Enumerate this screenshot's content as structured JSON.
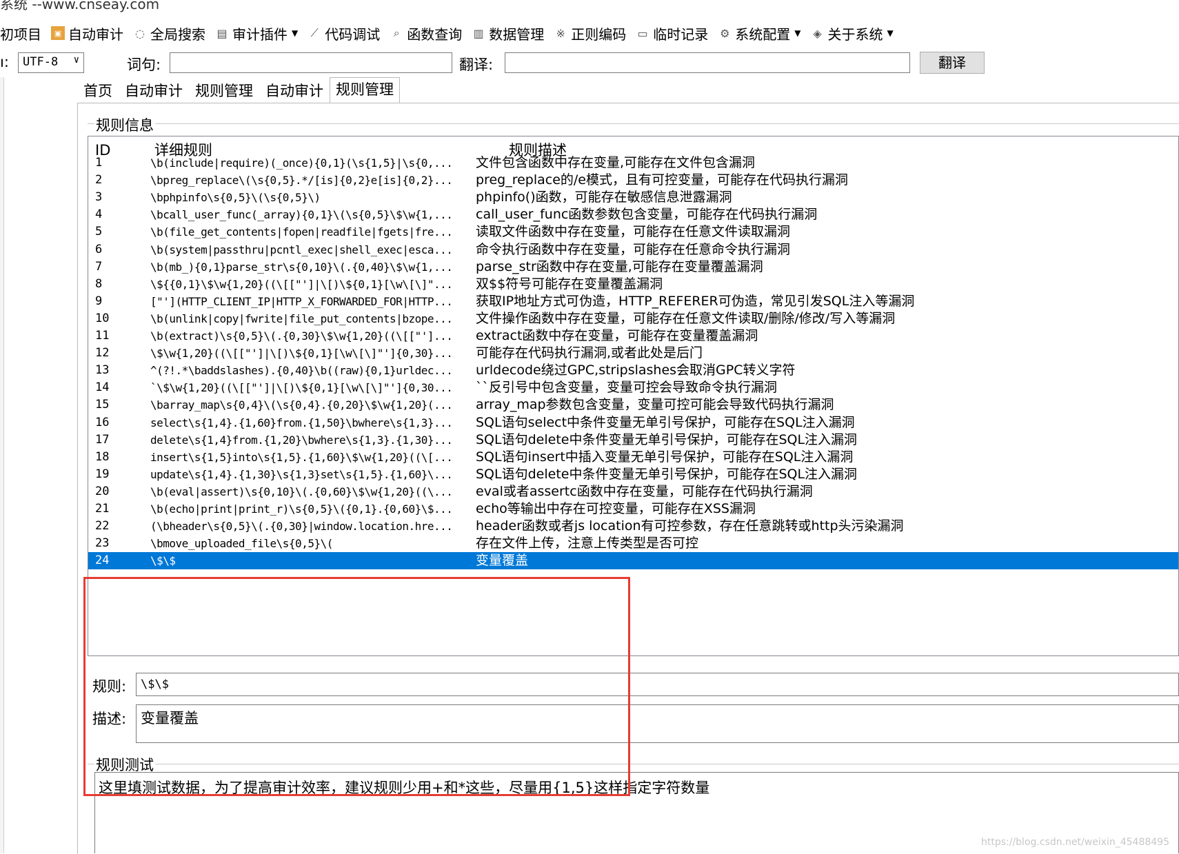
{
  "window": {
    "title": "系统 --www.cnseay.com"
  },
  "toolbar": {
    "items": [
      {
        "label": "初项目",
        "icon": "",
        "dropdown": false
      },
      {
        "label": "自动审计",
        "icon": "auto-audit-icon",
        "dropdown": false
      },
      {
        "label": "全局搜索",
        "icon": "speech-bubble-icon",
        "dropdown": false
      },
      {
        "label": "审计插件",
        "icon": "plugin-icon",
        "dropdown": true
      },
      {
        "label": "代码调试",
        "icon": "wand-icon",
        "dropdown": false
      },
      {
        "label": "函数查询",
        "icon": "search-icon",
        "dropdown": false
      },
      {
        "label": "数据管理",
        "icon": "data-icon",
        "dropdown": false
      },
      {
        "label": "正则编码",
        "icon": "regex-icon",
        "dropdown": false
      },
      {
        "label": "临时记录",
        "icon": "note-icon",
        "dropdown": false
      },
      {
        "label": "系统配置",
        "icon": "gear-icon",
        "dropdown": true
      },
      {
        "label": "关于系统",
        "icon": "info-icon",
        "dropdown": true
      }
    ]
  },
  "encoding": {
    "label": "ı:",
    "value": "UTF-8",
    "word_label": "词句:",
    "word_value": "",
    "translate_label": "翻译:",
    "translate_value": "",
    "translate_button": "翻译"
  },
  "tabs": [
    "首页",
    "自动审计",
    "规则管理",
    "自动审计",
    "规则管理"
  ],
  "active_tab": 4,
  "rule_info": {
    "group_title": "规则信息",
    "columns": [
      "ID",
      "详细规则",
      "规则描述"
    ],
    "rows": [
      {
        "id": "1",
        "rule": "\\b(include|require)(_once){0,1}(\\s{1,5}|\\s{0,...",
        "desc": "文件包含函数中存在变量,可能存在文件包含漏洞"
      },
      {
        "id": "2",
        "rule": "\\bpreg_replace\\(\\s{0,5}.*/[is]{0,2}e[is]{0,2}...",
        "desc": "preg_replace的/e模式，且有可控变量，可能存在代码执行漏洞"
      },
      {
        "id": "3",
        "rule": "\\bphpinfo\\s{0,5}\\(\\s{0,5}\\)",
        "desc": "phpinfo()函数，可能存在敏感信息泄露漏洞"
      },
      {
        "id": "4",
        "rule": "\\bcall_user_func(_array){0,1}\\(\\s{0,5}\\$\\w{1,...",
        "desc": "call_user_func函数参数包含变量，可能存在代码执行漏洞"
      },
      {
        "id": "5",
        "rule": "\\b(file_get_contents|fopen|readfile|fgets|fre...",
        "desc": "读取文件函数中存在变量，可能存在任意文件读取漏洞"
      },
      {
        "id": "6",
        "rule": "\\b(system|passthru|pcntl_exec|shell_exec|esca...",
        "desc": "命令执行函数中存在变量，可能存在任意命令执行漏洞"
      },
      {
        "id": "7",
        "rule": "\\b(mb_){0,1}parse_str\\s{0,10}\\(.{0,40}\\$\\w{1,...",
        "desc": "parse_str函数中存在变量,可能存在变量覆盖漏洞"
      },
      {
        "id": "8",
        "rule": "\\${{0,1}\\$\\w{1,20}((\\[[\"']|\\[)\\${0,1}[\\w\\[\\]\"...",
        "desc": "双$$符号可能存在变量覆盖漏洞"
      },
      {
        "id": "9",
        "rule": "[\"'](HTTP_CLIENT_IP|HTTP_X_FORWARDED_FOR|HTTP...",
        "desc": "获取IP地址方式可伪造，HTTP_REFERER可伪造，常见引发SQL注入等漏洞"
      },
      {
        "id": "10",
        "rule": "\\b(unlink|copy|fwrite|file_put_contents|bzope...",
        "desc": "文件操作函数中存在变量，可能存在任意文件读取/删除/修改/写入等漏洞"
      },
      {
        "id": "11",
        "rule": "\\b(extract)\\s{0,5}\\(.{0,30}\\$\\w{1,20}((\\[[\"']...",
        "desc": "extract函数中存在变量，可能存在变量覆盖漏洞"
      },
      {
        "id": "12",
        "rule": "\\$\\w{1,20}((\\[[\"']|\\[)\\${0,1}[\\w\\[\\]\"']{0,30}...",
        "desc": "可能存在代码执行漏洞,或者此处是后门"
      },
      {
        "id": "13",
        "rule": "^(?!.*\\baddslashes).{0,40}\\b((raw){0,1}urldec...",
        "desc": "urldecode绕过GPC,stripslashes会取消GPC转义字符"
      },
      {
        "id": "14",
        "rule": "`\\$\\w{1,20}((\\[[\"']|\\[)\\${0,1}[\\w\\[\\]\"']{0,30...",
        "desc": "``反引号中包含变量，变量可控会导致命令执行漏洞"
      },
      {
        "id": "15",
        "rule": "\\barray_map\\s{0,4}\\(\\s{0,4}.{0,20}\\$\\w{1,20}(...",
        "desc": "array_map参数包含变量，变量可控可能会导致代码执行漏洞"
      },
      {
        "id": "16",
        "rule": "select\\s{1,4}.{1,60}from.{1,50}\\bwhere\\s{1,3}...",
        "desc": "SQL语句select中条件变量无单引号保护，可能存在SQL注入漏洞"
      },
      {
        "id": "17",
        "rule": "delete\\s{1,4}from.{1,20}\\bwhere\\s{1,3}.{1,30}...",
        "desc": "SQL语句delete中条件变量无单引号保护，可能存在SQL注入漏洞"
      },
      {
        "id": "18",
        "rule": "insert\\s{1,5}into\\s{1,5}.{1,60}\\$\\w{1,20}((\\[...",
        "desc": "SQL语句insert中插入变量无单引号保护，可能存在SQL注入漏洞"
      },
      {
        "id": "19",
        "rule": "update\\s{1,4}.{1,30}\\s{1,3}set\\s{1,5}.{1,60}\\...",
        "desc": "SQL语句delete中条件变量无单引号保护，可能存在SQL注入漏洞"
      },
      {
        "id": "20",
        "rule": "\\b(eval|assert)\\s{0,10}\\(.{0,60}\\$\\w{1,20}((\\...",
        "desc": "eval或者assertc函数中存在变量，可能存在代码执行漏洞"
      },
      {
        "id": "21",
        "rule": "\\b(echo|print|print_r)\\s{0,5}\\({0,1}.{0,60}\\$...",
        "desc": "echo等输出中存在可控变量，可能存在XSS漏洞"
      },
      {
        "id": "22",
        "rule": "(\\bheader\\s{0,5}\\(.{0,30}|window.location.hre...",
        "desc": "header函数或者js location有可控参数，存在任意跳转或http头污染漏洞"
      },
      {
        "id": "23",
        "rule": "\\bmove_uploaded_file\\s{0,5}\\(",
        "desc": "存在文件上传，注意上传类型是否可控"
      },
      {
        "id": "24",
        "rule": "\\$\\$",
        "desc": "变量覆盖"
      }
    ],
    "selected_row": 24
  },
  "detail": {
    "rule_label": "规则:",
    "rule_value": "\\$\\$",
    "desc_label": "描述:",
    "desc_value": "变量覆盖"
  },
  "rule_test": {
    "group_title": "规则测试",
    "text": "这里填测试数据，为了提高审计效率，建议规则少用+和*这些，尽量用{1,5}这样指定字符数量"
  },
  "watermark": "https://blog.csdn.net/weixin_45488495",
  "colors": {
    "selection": "#0078d7",
    "highlight_box": "#e63b32"
  }
}
